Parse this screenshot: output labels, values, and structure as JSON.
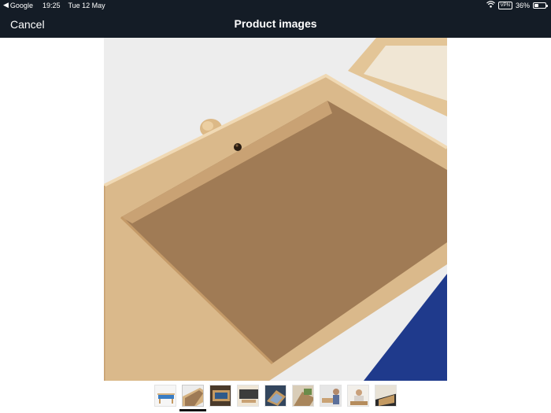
{
  "status": {
    "back_app": "Google",
    "time": "19:25",
    "date": "Tue 12 May",
    "vpn": "VPN",
    "battery_text": "36%",
    "battery_level": 0.36
  },
  "nav": {
    "cancel_label": "Cancel",
    "title": "Product images"
  },
  "gallery": {
    "selected_index": 1,
    "thumbnail_count": 9,
    "main_image_icon": "wooden-frame-tray-photo"
  },
  "colors": {
    "bar_bg": "#141c26",
    "wood": "#d9b98a",
    "board": "#9e7a55",
    "felt": "#1f3a8c"
  }
}
